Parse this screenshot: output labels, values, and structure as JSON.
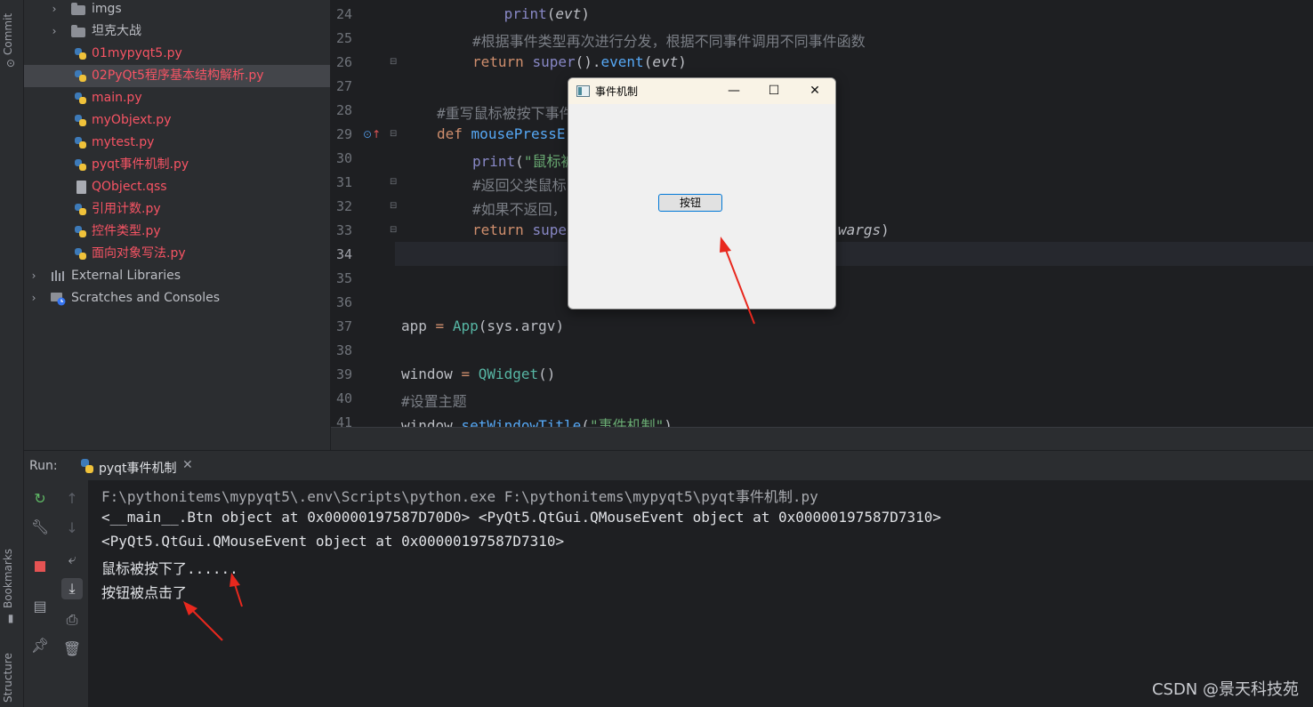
{
  "left_strip": {
    "commit": "Commit",
    "bookmarks": "Bookmarks",
    "structure": "Structure"
  },
  "project_tree": {
    "items": [
      {
        "label": "imgs",
        "kind": "folder",
        "expandable": true,
        "color": "gray"
      },
      {
        "label": "坦克大战",
        "kind": "folder",
        "expandable": true,
        "color": "gray"
      },
      {
        "label": "01mypyqt5.py",
        "kind": "python",
        "color": "red"
      },
      {
        "label": "02PyQt5程序基本结构解析.py",
        "kind": "python",
        "color": "red",
        "selected": true
      },
      {
        "label": "main.py",
        "kind": "python",
        "color": "red"
      },
      {
        "label": "myObjext.py",
        "kind": "python",
        "color": "red"
      },
      {
        "label": "mytest.py",
        "kind": "python",
        "color": "red"
      },
      {
        "label": "pyqt事件机制.py",
        "kind": "python",
        "color": "red"
      },
      {
        "label": "QObject.qss",
        "kind": "file",
        "color": "red"
      },
      {
        "label": "引用计数.py",
        "kind": "python",
        "color": "red"
      },
      {
        "label": "控件类型.py",
        "kind": "python",
        "color": "red"
      },
      {
        "label": "面向对象写法.py",
        "kind": "python",
        "color": "red"
      }
    ],
    "external_libraries": "External Libraries",
    "scratches": "Scratches and Consoles"
  },
  "editor": {
    "line_numbers": [
      "24",
      "25",
      "26",
      "27",
      "28",
      "29",
      "30",
      "31",
      "32",
      "33",
      "34",
      "35",
      "36",
      "37",
      "38",
      "39",
      "40",
      "41"
    ],
    "current_line": "34",
    "lines": {
      "l24_fn": "print",
      "l24_arg": "evt",
      "l25": "#根据事件类型再次进行分发，根据不同事件调用不同事件函数",
      "l26_kw": "return",
      "l26_super": "super",
      "l26_call": "event",
      "l26_arg": "evt",
      "l28": "#重写鼠标被按下事件",
      "l29_kw": "def",
      "l29_fn": "mousePressE",
      "l30_fn": "print",
      "l30_str": "\"鼠标被",
      "l31": "#返回父类鼠标",
      "l32": "#如果不返回，",
      "l33_kw": "return",
      "l33_super": "supe",
      "l33_tail": "wargs",
      "l37_a": "app",
      "l37_cls": "App",
      "l37_args": "sys.argv",
      "l39_a": "window",
      "l39_cls": "QWidget",
      "l40": "#设置主题",
      "l41_a": "window",
      "l41_m": "setWindowTitle",
      "l41_str": "\"事件机制\""
    }
  },
  "dialog": {
    "title": "事件机制",
    "minimize": "—",
    "maximize": "☐",
    "close": "✕",
    "button_label": "按钮"
  },
  "run_panel": {
    "label": "Run:",
    "tab_label": "pyqt事件机制",
    "tab_close": "✕",
    "console_lines": [
      "F:\\pythonitems\\mypyqt5\\.env\\Scripts\\python.exe F:\\pythonitems\\mypyqt5\\pyqt事件机制.py",
      "<__main__.Btn object at 0x00000197587D70D0> <PyQt5.QtGui.QMouseEvent object at 0x00000197587D7310>",
      "<PyQt5.QtGui.QMouseEvent object at 0x00000197587D7310>",
      "鼠标被按下了......",
      "按钮被点击了"
    ]
  },
  "watermark": "CSDN @景天科技苑",
  "colors": {
    "editor_bg": "#1e1f22",
    "panel_bg": "#2b2d30",
    "keyword": "#cf8e6d",
    "comment": "#7a7e85",
    "function": "#56a8f5",
    "string": "#6aab73",
    "modified_file": "#f75464",
    "annotation_arrow": "#e8281e"
  }
}
